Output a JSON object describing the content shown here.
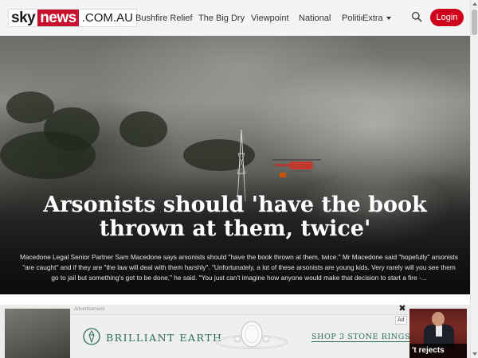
{
  "header": {
    "logo": {
      "sky": "sky",
      "news": "news",
      "domain": ".COM.AU"
    },
    "nav": [
      {
        "label": "Bushfire Relief"
      },
      {
        "label": "The Big Dry"
      },
      {
        "label": "Viewpoint"
      },
      {
        "label": "National"
      },
      {
        "label": "Politics",
        "overlay": "Extra",
        "has_dropdown": true
      }
    ],
    "search_icon": "search-icon",
    "login_label": "Login",
    "accent_color": "#d0021b"
  },
  "hero": {
    "title": "Arsonists should 'have the book thrown at them, twice'",
    "summary": "Macedone Legal Senior Partner Sam Macedone says arsonists should \"have the book thrown at them, twice.\" Mr Macedone said \"hopefully\" arsonists \"are caught\" and if they are \"the law will deal with them harshly\". \"Unfortunately, a lot of these arsonists are young kids. Very rarely will you see them go to jail but something's got to be done,\" he said. \"You just can't imagine how anyone would make that decision to start a fire -..."
  },
  "advertisement": {
    "label": "Advertisement",
    "close_icon": "close-icon",
    "badge": "Ad",
    "brand": "BRILLIANT EARTH",
    "cta": "SHOP 3 STONE RINGS",
    "brand_color": "#2e6a57"
  },
  "side_story": {
    "caption": "'t rejects"
  }
}
